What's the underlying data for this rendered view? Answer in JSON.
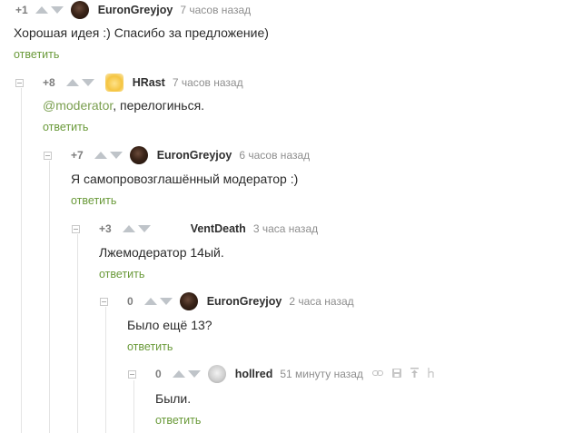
{
  "comments": [
    {
      "rating": "+1",
      "author": "EuronGreyjoy",
      "time": "7 часов назад",
      "text": "Хорошая идея :) Спасибо за предложение)",
      "reply": "ответить",
      "avatar": "dark-portrait-avatar"
    },
    {
      "rating": "+8",
      "author": "HRast",
      "time": "7 часов назад",
      "mention": "@moderator",
      "text": ", перелогинься.",
      "reply": "ответить",
      "avatar": "sun-avatar"
    },
    {
      "rating": "+7",
      "author": "EuronGreyjoy",
      "time": "6 часов назад",
      "text": "Я самопровозглашённый модератор :)",
      "reply": "ответить",
      "avatar": "dark-portrait-avatar"
    },
    {
      "rating": "+3",
      "author": "VentDeath",
      "time": "3 часа назад",
      "text": "Лжемодератор 14ый.",
      "reply": "ответить",
      "avatar": "none"
    },
    {
      "rating": "0",
      "author": "EuronGreyjoy",
      "time": "2 часа назад",
      "text": "Было ещё 13?",
      "reply": "ответить",
      "avatar": "dark-portrait-avatar"
    },
    {
      "rating": "0",
      "author": "hollred",
      "time": "51 минуту назад",
      "text": "Были.",
      "reply": "ответить",
      "avatar": "dog-avatar",
      "tools": [
        "link-icon",
        "save-icon",
        "go-to-parent-icon",
        "h-icon"
      ]
    }
  ],
  "colors": {
    "accent": "#6a9a3a",
    "vote_arrow": "#bfc4c9",
    "meta": "#8e8e8e"
  }
}
